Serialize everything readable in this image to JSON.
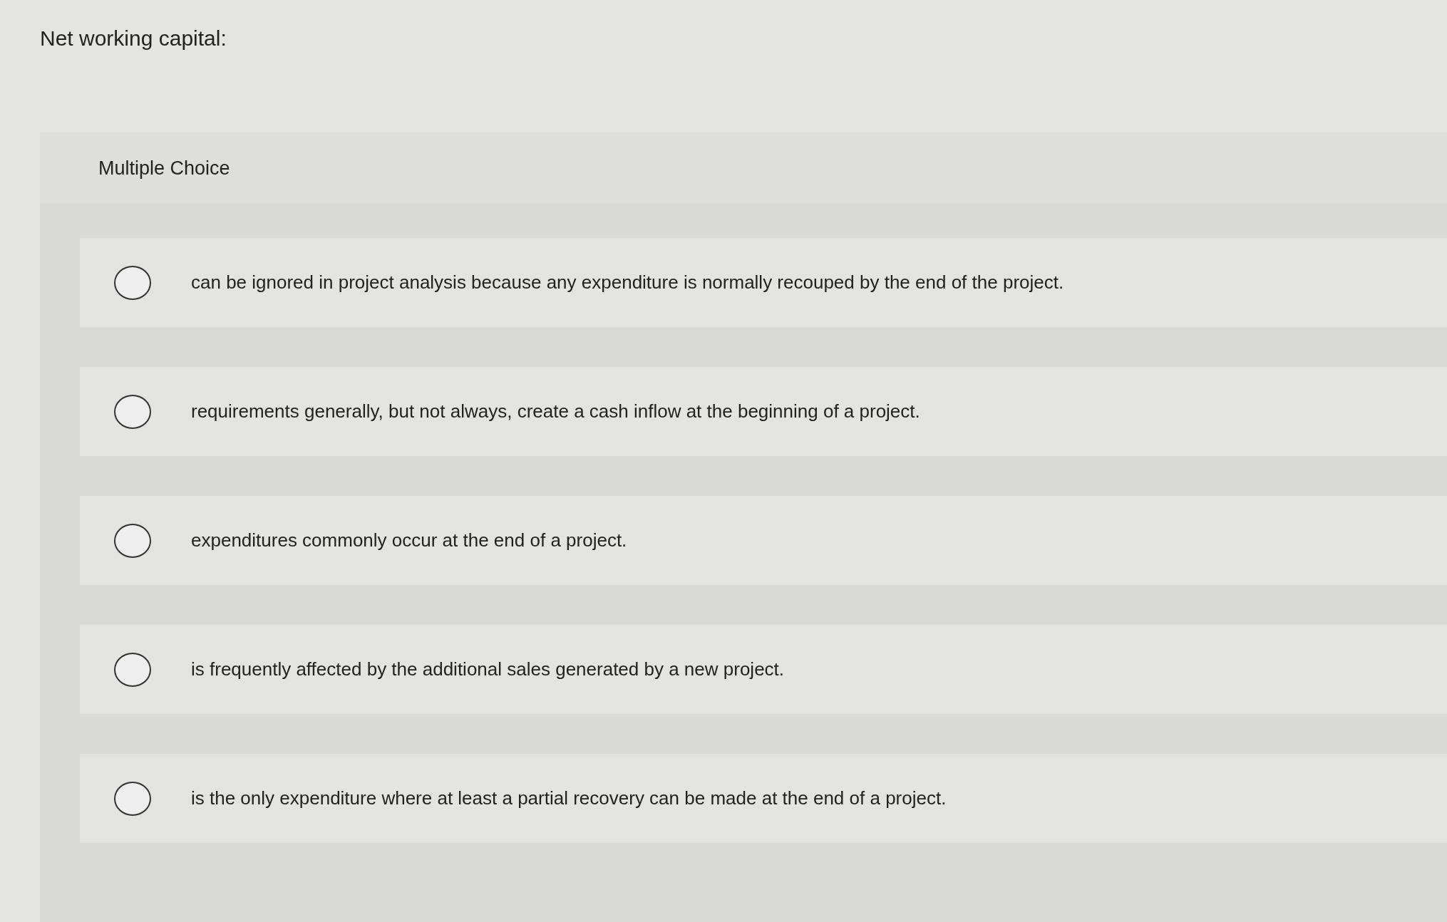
{
  "question": {
    "title": "Net working capital:"
  },
  "panel": {
    "heading": "Multiple Choice"
  },
  "options": [
    {
      "text": "can be ignored in project analysis because any expenditure is normally recouped by the end of the project.",
      "selected": false
    },
    {
      "text": "requirements generally, but not always, create a cash inflow at the beginning of a project.",
      "selected": false
    },
    {
      "text": "expenditures commonly occur at the end of a project.",
      "selected": false
    },
    {
      "text": "is frequently affected by the additional sales generated by a new project.",
      "selected": false
    },
    {
      "text": "is the only expenditure where at least a partial recovery can be made at the end of a project.",
      "selected": false
    }
  ]
}
